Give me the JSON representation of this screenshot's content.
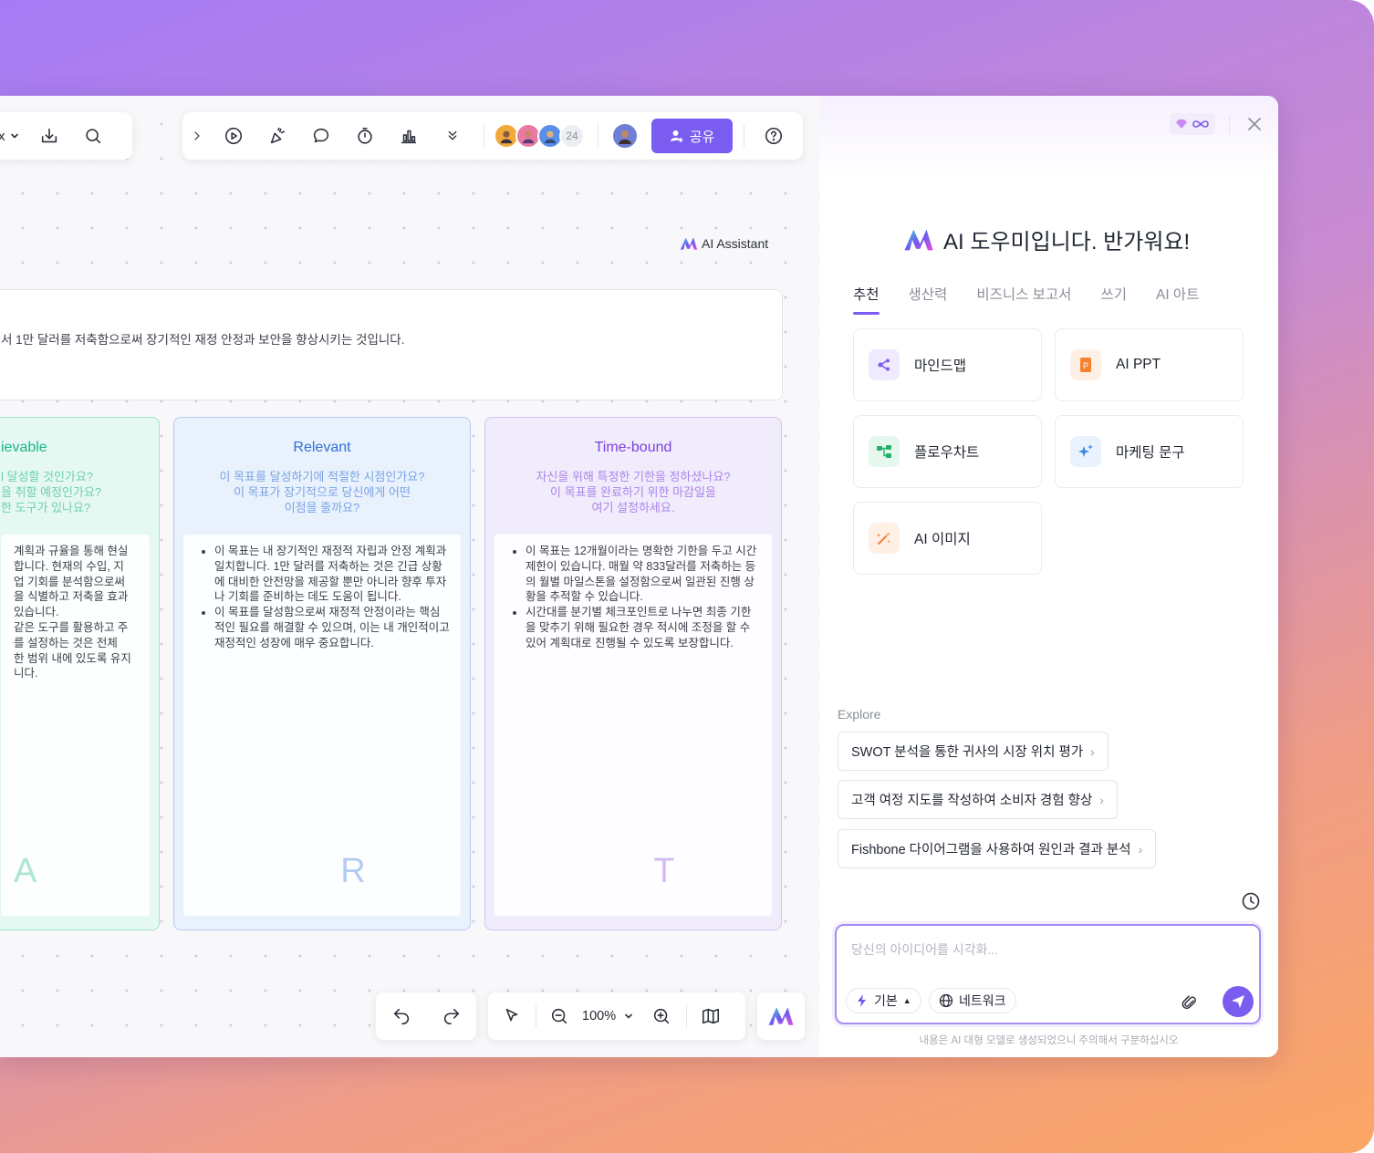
{
  "toolbar_left": {
    "partial_label": "x"
  },
  "toolbar_main": {
    "collaborator_count": "24",
    "share_label": "공유"
  },
  "canvas": {
    "ai_assistant_label": "AI Assistant",
    "goal_text": "서 1만 달러를 저축함으로써 장기적인 재정 안정과 보안을 향상시키는 것입니다.",
    "cards": [
      {
        "title": "ievable",
        "questions": [
          "l 달성할 것인가요?",
          "을 취할 예정인가요?",
          "한 도구가 있나요?"
        ],
        "bullets": [
          "계획과 규율을 통해 현실\n합니다. 현재의 수입, 지\n업 기회를 분석함으로써\n을 식별하고 저축을 효과\n있습니다.\n같은 도구를 활용하고 주\n를 설정하는 것은 전체\n한 범위 내에 있도록 유지\n니다."
        ],
        "letter": "A",
        "color": "#19b58a",
        "bg": "#e6f8f2",
        "border": "#9fe3cd"
      },
      {
        "title": "Relevant",
        "questions": [
          "이 목표를 달성하기에 적절한 시점인가요?",
          "이 목표가 장기적으로 당신에게 어떤",
          "이점을 줄까요?"
        ],
        "bullets": [
          "이 목표는 내 장기적인 재정적 자립과 안정 계획과 일치합니다. 1만 달러를 저축하는 것은 긴급 상황에 대비한 안전망을 제공할 뿐만 아니라 향후 투자나 기회를 준비하는 데도 도움이 됩니다.",
          "이 목표를 달성함으로써 재정적 안정이라는 핵심적인 필요를 해결할 수 있으며, 이는 내 개인적이고 재정적인 성장에 매우 중요합니다."
        ],
        "letter": "R",
        "color": "#2f6fd6",
        "bg": "#e9f1fc",
        "border": "#b6cdf2"
      },
      {
        "title": "Time-bound",
        "questions": [
          "자신을 위해 특정한 기한을 정하셨나요?",
          "이 목표를 완료하기 위한 마감일을",
          "여기 설정하세요."
        ],
        "bullets": [
          "이 목표는 12개월이라는 명확한 기한을 두고 시간 제한이 있습니다. 매월 약 833달러를 저축하는 등의 월별 마일스톤을 설정함으로써 일관된 진행 상황을 추적할 수 있습니다.",
          "시간대를 분기별 체크포인트로 나누면 최종 기한을 맞추기 위해 필요한 경우 적시에 조정을 할 수 있어 계획대로 진행될 수 있도록 보장합니다."
        ],
        "letter": "T",
        "color": "#7c3fe0",
        "bg": "#f1ecfb",
        "border": "#d3c3f3"
      }
    ]
  },
  "bottom_bar": {
    "zoom": "100%"
  },
  "panel": {
    "title": "AI 도우미입니다. 반가워요!",
    "tabs": [
      "추천",
      "생산력",
      "비즈니스 보고서",
      "쓰기",
      "AI 아트"
    ],
    "features": [
      {
        "label": "마인드맵",
        "icon": "mindmap-icon",
        "bg": "#efeafd",
        "fg": "#7b5cf0"
      },
      {
        "label": "AI PPT",
        "icon": "ppt-icon",
        "bg": "#fff0e6",
        "fg": "#f4822f"
      },
      {
        "label": "플로우차트",
        "icon": "flowchart-icon",
        "bg": "#e6f7ee",
        "fg": "#24b06a"
      },
      {
        "label": "마케팅 문구",
        "icon": "sparkle-icon",
        "bg": "#eaf2fd",
        "fg": "#3a86e8"
      },
      {
        "label": "AI 이미지",
        "icon": "image-brush-icon",
        "bg": "#fff0e6",
        "fg": "#f4822f"
      }
    ],
    "explore_label": "Explore",
    "explore_items": [
      "SWOT 분석을 통한 귀사의 시장 위치 평가",
      "고객 여정 지도를 작성하여 소비자 경험 향상",
      "Fishbone 다이어그램을 사용하여 원인과 결과 분석"
    ],
    "input_placeholder": "당신의 아이디어를 시각화...",
    "mode_label": "기본",
    "network_label": "네트워크",
    "disclaimer": "내용은 AI 대형 모델로 생성되었으니 주의해서 구분하십시오"
  }
}
